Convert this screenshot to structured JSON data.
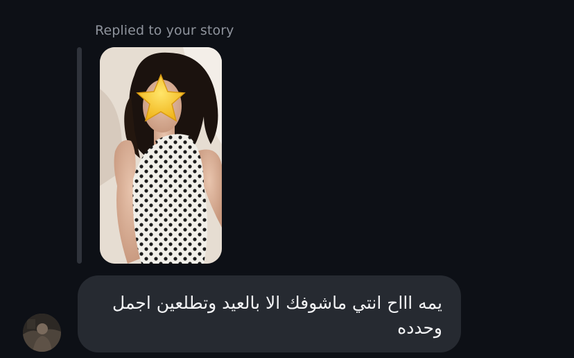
{
  "story_reply": {
    "caption": "Replied to your story",
    "thumbnail": {
      "description_icon": "star-emoji",
      "star_color": "#f6c320"
    }
  },
  "message": {
    "text": "يمه اااح انتي ماشوفك الا بالعيد وتطلعين اجمل وحدده"
  },
  "sender": {
    "avatar_icon": "profile-photo"
  },
  "colors": {
    "background": "#0d1016",
    "bubble": "#262a31",
    "caption": "#8e939c",
    "text": "#f2f3f5"
  }
}
